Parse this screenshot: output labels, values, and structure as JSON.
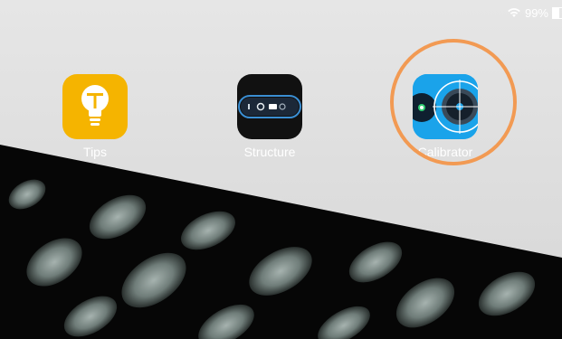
{
  "status_bar": {
    "battery_percent": "99%",
    "wifi_icon": "wifi-icon",
    "battery_icon": "battery-icon"
  },
  "apps": [
    {
      "label": "Tips",
      "icon": "lightbulb-icon",
      "color": "#f5b400"
    },
    {
      "label": "Structure",
      "icon": "structure-sensor-icon",
      "color": "#111111"
    },
    {
      "label": "Calibrator",
      "icon": "calibrator-icon",
      "color": "#1aa3ea"
    }
  ],
  "annotation": {
    "highlight_color": "#f29a53"
  }
}
